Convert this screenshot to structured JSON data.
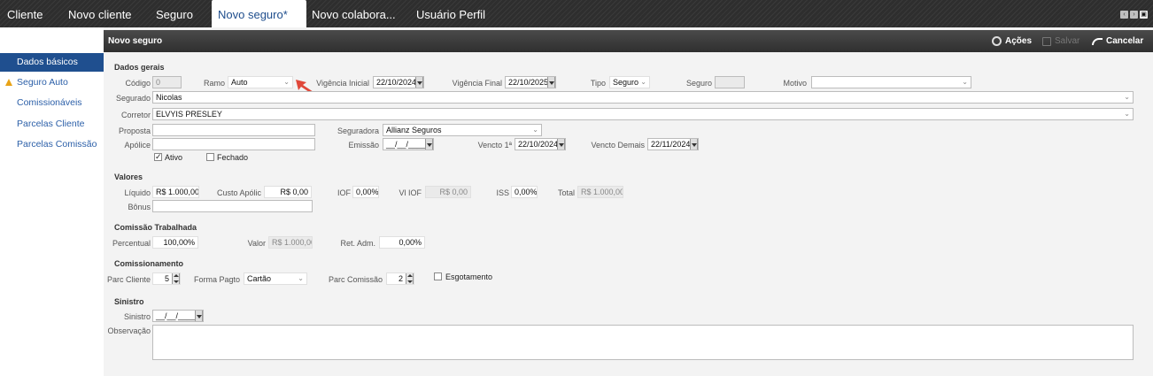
{
  "tabs": [
    {
      "label": "Cliente"
    },
    {
      "label": "Novo cliente"
    },
    {
      "label": "Seguro"
    },
    {
      "label": "Novo seguro*"
    },
    {
      "label": "Novo colabora..."
    },
    {
      "label": "Usuário Perfil"
    }
  ],
  "sidebar": {
    "items": [
      {
        "label": "Dados básicos"
      },
      {
        "label": "Seguro Auto"
      },
      {
        "label": "Comissionáveis"
      },
      {
        "label": "Parcelas Cliente"
      },
      {
        "label": "Parcelas Comissão"
      }
    ]
  },
  "header": {
    "title": "Novo seguro",
    "actions_label": "Ações",
    "save_label": "Salvar",
    "cancel_label": "Cancelar"
  },
  "dados_gerais": {
    "section": "Dados gerais",
    "codigo_label": "Código",
    "codigo_value": "0",
    "ramo_label": "Ramo",
    "ramo_value": "Auto",
    "vig_inicial_label": "Vigência Inicial",
    "vig_inicial_value": "22/10/2024",
    "vig_final_label": "Vigência Final",
    "vig_final_value": "22/10/2025",
    "tipo_label": "Tipo",
    "tipo_value": "Seguro",
    "seguro_label": "Seguro",
    "seguro_value": "",
    "motivo_label": "Motivo",
    "motivo_value": "",
    "segurado_label": "Segurado",
    "segurado_value": "Nicolas",
    "corretor_label": "Corretor",
    "corretor_value": "ELVYIS PRESLEY",
    "proposta_label": "Proposta",
    "proposta_value": "",
    "seguradora_label": "Seguradora",
    "seguradora_value": "Allianz Seguros",
    "apolice_label": "Apólice",
    "apolice_value": "",
    "emissao_label": "Emissão",
    "emissao_value": "__/__/____",
    "vencto1_label": "Vencto 1ª",
    "vencto1_value": "22/10/2024",
    "vencto_demais_label": "Vencto Demais",
    "vencto_demais_value": "22/11/2024",
    "ativo_label": "Ativo",
    "ativo_checked": true,
    "fechado_label": "Fechado",
    "fechado_checked": false
  },
  "valores": {
    "section": "Valores",
    "liquido_label": "Líquido",
    "liquido_value": "R$ 1.000,00",
    "custo_label": "Custo Apólic",
    "custo_value": "R$ 0,00",
    "iof_label": "IOF",
    "iof_value": "0,00%",
    "vl_iof_label": "Vl IOF",
    "vl_iof_value": "R$ 0,00",
    "iss_label": "ISS",
    "iss_value": "0,00%",
    "total_label": "Total",
    "total_value": "R$ 1.000,00",
    "bonus_label": "Bônus",
    "bonus_value": ""
  },
  "comissao": {
    "section": "Comissão Trabalhada",
    "percentual_label": "Percentual",
    "percentual_value": "100,00%",
    "valor_label": "Valor",
    "valor_value": "R$ 1.000,00",
    "ret_label": "Ret. Adm.",
    "ret_value": "0,00%"
  },
  "comissionamento": {
    "section": "Comissionamento",
    "parc_cliente_label": "Parc Cliente",
    "parc_cliente_value": "5",
    "forma_label": "Forma Pagto",
    "forma_value": "Cartão",
    "parc_comissao_label": "Parc Comissão",
    "parc_comissao_value": "2",
    "esgotamento_label": "Esgotamento",
    "esgotamento_checked": false
  },
  "sinistro": {
    "section": "Sinistro",
    "sinistro_label": "Sinistro",
    "sinistro_value": "__/__/____",
    "observacao_label": "Observação",
    "observacao_value": ""
  },
  "colors": {
    "accent": "#1f4f8f",
    "header_bg": "#2e2e2e",
    "annotation_arrow": "#e0483a",
    "warning": "#e8a317"
  }
}
